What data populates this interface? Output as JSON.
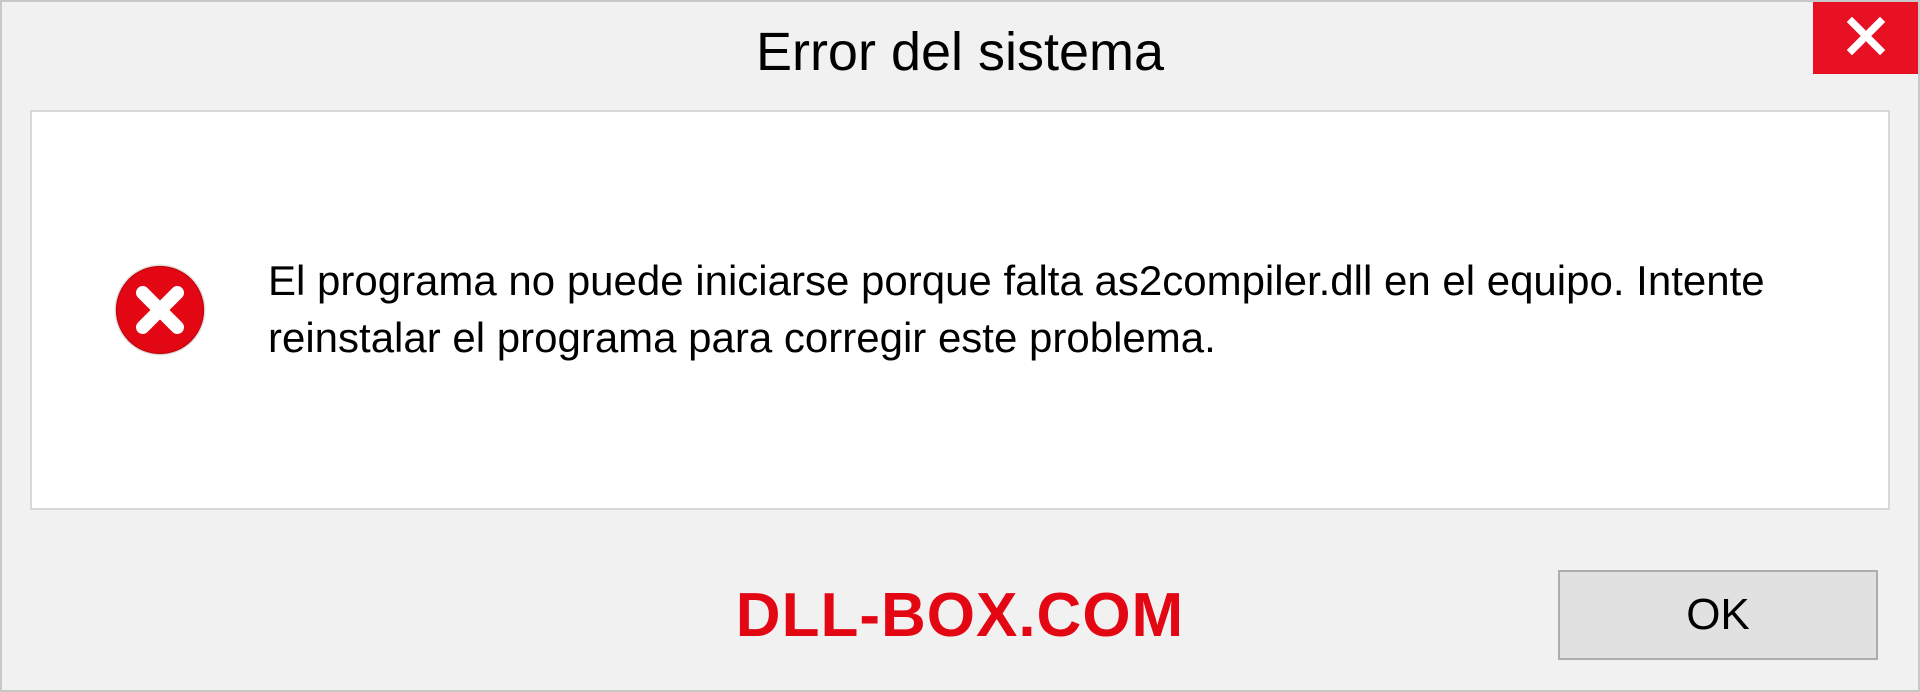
{
  "titlebar": {
    "title": "Error del sistema"
  },
  "message": {
    "text": "El programa no puede iniciarse porque falta as2compiler.dll en el equipo. Intente reinstalar el programa para corregir este problema."
  },
  "footer": {
    "watermark": "DLL-BOX.COM",
    "ok_label": "OK"
  },
  "colors": {
    "close_bg": "#e81123",
    "error_icon": "#e30613",
    "watermark": "#e30613"
  }
}
